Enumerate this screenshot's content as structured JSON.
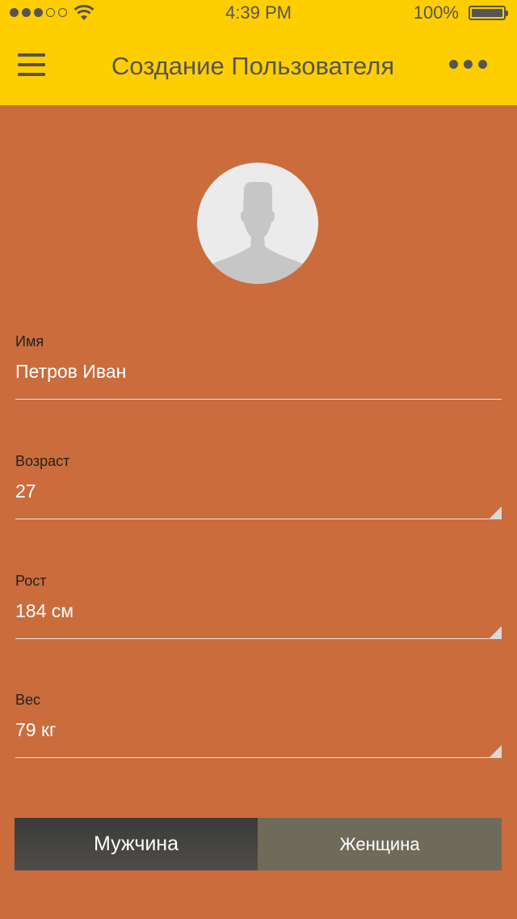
{
  "status_bar": {
    "time": "4:39 PM",
    "battery": "100%",
    "signal_dots_filled": 3,
    "signal_dots_total": 5
  },
  "header": {
    "title": "Создание Пользователя",
    "menu_icon": "hamburger-icon",
    "more_icon": "more-icon"
  },
  "avatar": {
    "icon": "user-silhouette-icon"
  },
  "fields": {
    "name": {
      "label": "Имя",
      "value": "Петров Иван"
    },
    "age": {
      "label": "Возраст",
      "value": "27"
    },
    "height": {
      "label": "Рост",
      "value": "184 см"
    },
    "weight": {
      "label": "Вес",
      "value": "79 кг"
    }
  },
  "gender": {
    "male": "Мужчина",
    "female": "Женщина",
    "selected": "male"
  },
  "colors": {
    "header": "#FFCE00",
    "background": "#CB6C3C",
    "text_dark": "#555555",
    "segment_selected": "#45433F",
    "segment_unselected": "#6F6B5B"
  }
}
